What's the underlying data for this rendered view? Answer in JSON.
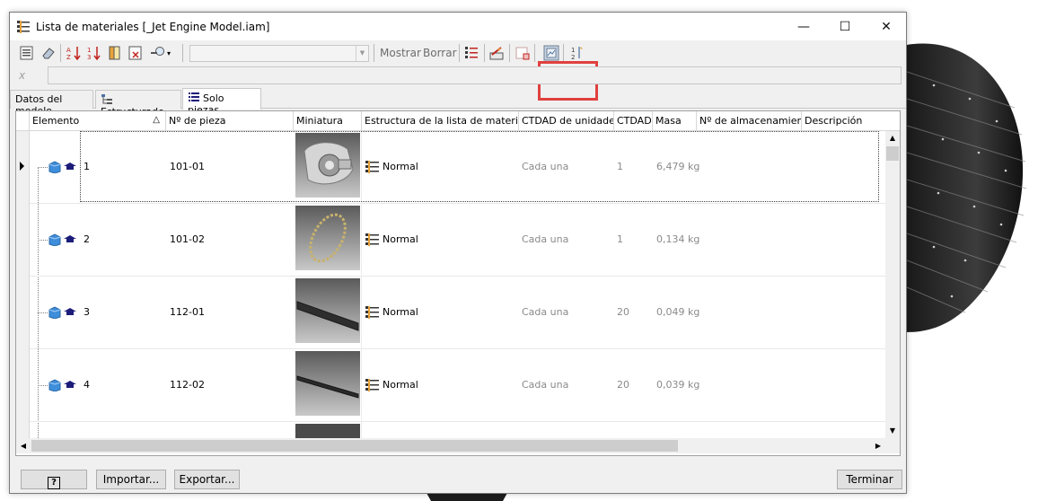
{
  "window": {
    "title": "Lista de materiales [_Jet Engine Model.iam]",
    "min_glyph": "—",
    "max_glyph": "☐",
    "close_glyph": "✕"
  },
  "toolbar": {
    "combo_value": "",
    "show_label": "Mostrar",
    "clear_label": "Borrar",
    "highlight_color": "#e0403f"
  },
  "formula": {
    "icon": "x",
    "value": ""
  },
  "tabs": [
    {
      "label": "Datos del modelo",
      "active": false
    },
    {
      "label": "Estructurado",
      "active": false
    },
    {
      "label": "Solo piezas",
      "active": true
    }
  ],
  "grid": {
    "columns": [
      "Elemento",
      "Nº de pieza",
      "Miniatura",
      "Estructura de la lista de materiales",
      "CTDAD de unidades",
      "CTDAD",
      "Masa",
      "Nº de almacenamiento",
      "Descripción"
    ],
    "sort_indicator": "△",
    "rows": [
      {
        "item": "1",
        "part": "101-01",
        "structure": "Normal",
        "unit_qty": "Cada una",
        "qty": "1",
        "mass": "6,479 kg",
        "stock": "",
        "desc": "",
        "thumb": "engine-casing"
      },
      {
        "item": "2",
        "part": "101-02",
        "structure": "Normal",
        "unit_qty": "Cada una",
        "qty": "1",
        "mass": "0,134 kg",
        "stock": "",
        "desc": "",
        "thumb": "ring"
      },
      {
        "item": "3",
        "part": "112-01",
        "structure": "Normal",
        "unit_qty": "Cada una",
        "qty": "20",
        "mass": "0,049 kg",
        "stock": "",
        "desc": "",
        "thumb": "blade"
      },
      {
        "item": "4",
        "part": "112-02",
        "structure": "Normal",
        "unit_qty": "Cada una",
        "qty": "20",
        "mass": "0,039 kg",
        "stock": "",
        "desc": "",
        "thumb": "rod"
      }
    ]
  },
  "footer": {
    "help_label": "?",
    "import_label": "Importar...",
    "export_label": "Exportar...",
    "finish_label": "Terminar"
  }
}
